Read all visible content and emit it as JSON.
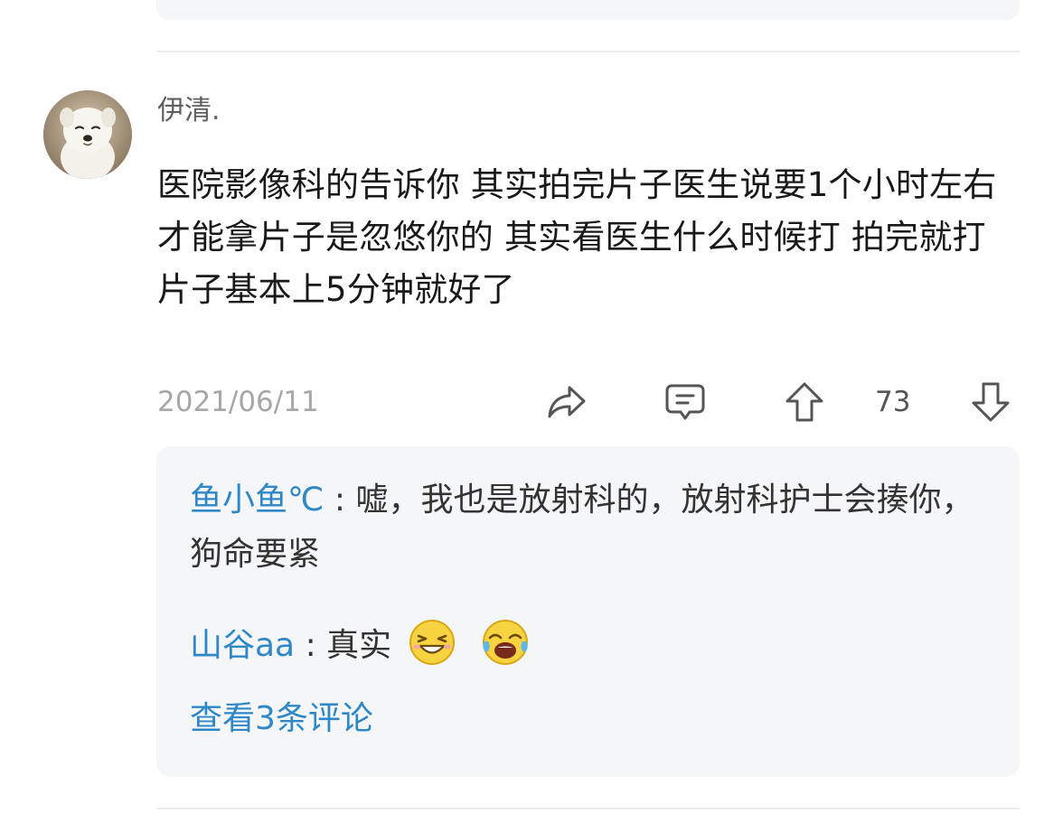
{
  "comment": {
    "username": "伊清.",
    "text": "医院影像科的告诉你 其实拍完片子医生说要1个小时左右才能拿片子是忽悠你的 其实看医生什么时候打 拍完就打片子基本上5分钟就好了",
    "date": "2021/06/11",
    "vote_count": "73",
    "avatar_icon": "dog-avatar",
    "actions": {
      "share_icon": "share-arrow-icon",
      "reply_icon": "comment-bubble-icon",
      "upvote_icon": "arrow-up-icon",
      "downvote_icon": "arrow-down-icon"
    }
  },
  "replies": [
    {
      "author": "鱼小鱼℃",
      "separator": ":",
      "text": "嘘，我也是放射科的，放射科护士会揍你，狗命要紧"
    },
    {
      "author": "山谷aa",
      "separator": ":",
      "text": "真实",
      "emojis": [
        "squinting-laugh-emoji",
        "laughing-crying-emoji"
      ]
    }
  ],
  "view_more_label": "查看3条评论",
  "colors": {
    "link": "#2f87c6",
    "muted": "#a7a7a7",
    "reply_bg": "#f5f6f8",
    "emoji_yellow": "#f7d241"
  }
}
